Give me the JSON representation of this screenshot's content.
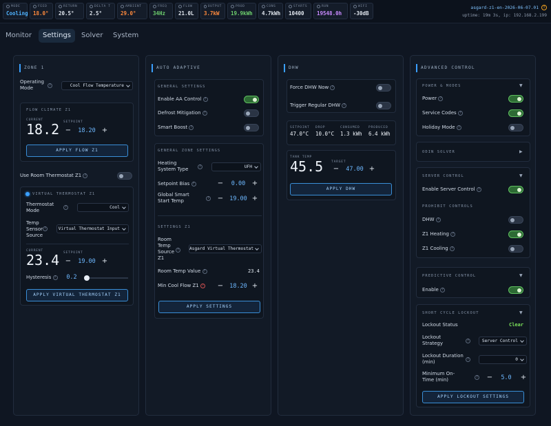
{
  "status_tiles": [
    {
      "label": "MODE",
      "value": "Cooling",
      "color": "#4fb3ff",
      "w": 36
    },
    {
      "label": "FEED",
      "value": "18.0°",
      "color": "#ff8a3d",
      "w": 34
    },
    {
      "label": "RETURN",
      "value": "20.5°",
      "color": "#e0e6ee",
      "w": 42
    },
    {
      "label": "DELTA T",
      "value": "2.5°",
      "color": "#e0e6ee",
      "w": 42
    },
    {
      "label": "AMBIENT",
      "value": "29.0°",
      "color": "#ff8a3d",
      "w": 44
    },
    {
      "label": "FREQ",
      "value": "34Hz",
      "color": "#6dcf6d",
      "w": 34
    },
    {
      "label": "FLOW",
      "value": "21.0L",
      "color": "#e0e6ee",
      "w": 34
    },
    {
      "label": "OUTPUT",
      "value": "3.7kW",
      "color": "#ff8a3d",
      "w": 36
    },
    {
      "label": "PROD",
      "value": "19.9kWh",
      "color": "#6dcf6d",
      "w": 42
    },
    {
      "label": "CONS",
      "value": "4.7kWh",
      "color": "#e0e6ee",
      "w": 36
    },
    {
      "label": "STARTS",
      "value": "10400",
      "color": "#e0e6ee",
      "w": 38
    },
    {
      "label": "RUN",
      "value": "19548.0h",
      "color": "#c98aff",
      "w": 50
    },
    {
      "label": "WIFI",
      "value": "-30dB",
      "color": "#e0e6ee",
      "w": 34
    }
  ],
  "header": {
    "host": "asgard-z1-en-2026-06-07.01",
    "uptime": "uptime: 19m 3s, ip: 192.168.2.199"
  },
  "tabs": [
    "Monitor",
    "Settings",
    "Solver",
    "System"
  ],
  "zone1": {
    "title": "ZONE 1",
    "operating_mode_label": "Operating Mode",
    "operating_mode_value": "Cool Flow Temperature",
    "flow_climate_title": "FLOW CLIMATE Z1",
    "current_label": "CURRENT",
    "setpoint_label": "SETPOINT",
    "flow_current": "18.2",
    "flow_setpoint": "18.20",
    "apply_flow": "APPLY FLOW Z1",
    "use_room_thermostat": "Use Room Thermostat Z1",
    "virtual_title": "VIRTUAL THERMOSTAT Z1",
    "thermostat_mode_label": "Thermostat Mode",
    "thermostat_mode_value": "Cool",
    "temp_sensor_label": "Temp Sensor Source",
    "temp_sensor_value": "Virtual Thermostat Input",
    "vt_current": "23.4",
    "vt_setpoint": "19.00",
    "hysteresis_label": "Hysteresis",
    "hysteresis_value": "0.2",
    "hysteresis_fraction": 0.0,
    "apply_vt": "APPLY VIRTUAL THERMOSTAT Z1"
  },
  "auto": {
    "title": "AUTO ADAPTIVE",
    "general_settings": "GENERAL SETTINGS",
    "enable_aa": "Enable AA Control",
    "defrost": "Defrost Mitigation",
    "smart_boost": "Smart Boost",
    "general_zone": "GENERAL ZONE SETTINGS",
    "heating_type_label": "Heating System Type",
    "heating_type_value": "UFH",
    "setpoint_bias_label": "Setpoint Bias",
    "setpoint_bias_value": "0.00",
    "smart_start_label": "Global Smart Start Temp",
    "smart_start_value": "19.00",
    "settings_z1": "SETTINGS Z1",
    "room_source_label": "Room Temp Source Z1",
    "room_source_value": "Asgard Virtual Thermostat",
    "room_temp_label": "Room Temp Value",
    "room_temp_value": "23.4",
    "min_cool_label": "Min Cool Flow Z1",
    "min_cool_value": "18.20",
    "apply": "APPLY SETTINGS"
  },
  "dhw": {
    "title": "DHW",
    "force_label": "Force DHW Now",
    "trigger_label": "Trigger Regular DHW",
    "stats": [
      {
        "label": "SETPOINT",
        "value": "47.0°C"
      },
      {
        "label": "DROP",
        "value": "10.0°C"
      },
      {
        "label": "CONSUMED",
        "value": "1.3 kWh"
      },
      {
        "label": "PRODUCED",
        "value": "6.4 kWh"
      }
    ],
    "tank_label": "TANK TEMP",
    "tank_value": "45.5",
    "target_label": "TARGET",
    "target_value": "47.00",
    "apply": "APPLY DHW"
  },
  "advanced": {
    "title": "ADVANCED CONTROL",
    "power_modes": "POWER & MODES",
    "power_label": "Power",
    "service_label": "Service Codes",
    "holiday_label": "Holiday Mode",
    "odin": "ODIN SOLVER",
    "server_control": "SERVER CONTROL",
    "enable_server_label": "Enable Server Control",
    "prohibit": "PROHIBIT CONTROLS",
    "dhw_label": "DHW",
    "z1_heating_label": "Z1 Heating",
    "z1_cooling_label": "Z1 Cooling",
    "predictive": "PREDICTIVE CONTROL",
    "enable_label": "Enable",
    "short_cycle": "SHORT CYCLE LOCKOUT",
    "lockout_status_label": "Lockout Status",
    "lockout_status_value": "Clear",
    "lockout_strategy_label": "Lockout Strategy",
    "lockout_strategy_value": "Server Control",
    "lockout_duration_label": "Lockout Duration (min)",
    "lockout_duration_value": "0",
    "min_on_label": "Minimum On-Time (min)",
    "min_on_value": "5.0",
    "apply": "APPLY LOCKOUT SETTINGS"
  },
  "colors": {
    "accent": "#3aa0ff",
    "toggle_on": "#5fbf5f",
    "clear": "#7be05a"
  }
}
